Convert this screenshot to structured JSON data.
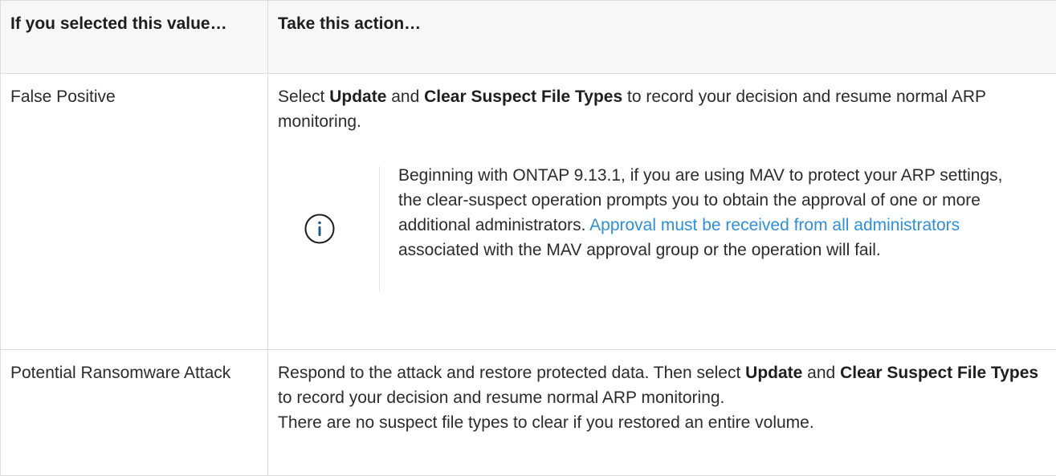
{
  "table": {
    "headers": {
      "value": "If you selected this value…",
      "action": "Take this action…"
    },
    "rows": [
      {
        "value": "False Positive",
        "action": {
          "part1": "Select ",
          "bold1": "Update",
          "part2": " and ",
          "bold2": "Clear Suspect File Types",
          "part3": " to record your decision and resume normal ARP monitoring."
        },
        "note": {
          "icon": "info-icon",
          "text_before_link": "Beginning with ONTAP 9.13.1, if you are using MAV to protect your ARP settings, the clear-suspect operation prompts you to obtain the approval of one or more additional administrators. ",
          "link_text": "Approval must be received from all administrators",
          "text_after_link": " associated with the MAV approval group or the operation will fail."
        }
      },
      {
        "value": "Potential Ransomware Attack",
        "action": {
          "part1": "Respond to the attack and restore protected data. Then select ",
          "bold1": "Update",
          "part2": " and ",
          "bold2": "Clear Suspect File Types",
          "part3": " to record your decision and resume normal ARP monitoring.",
          "line2": "There are no suspect file types to clear if you restored an entire volume."
        }
      }
    ]
  },
  "colors": {
    "link": "#2f8fd8",
    "border": "#dcdcdc",
    "header_bg": "#f7f7f7",
    "icon": "#1f5a8a"
  }
}
